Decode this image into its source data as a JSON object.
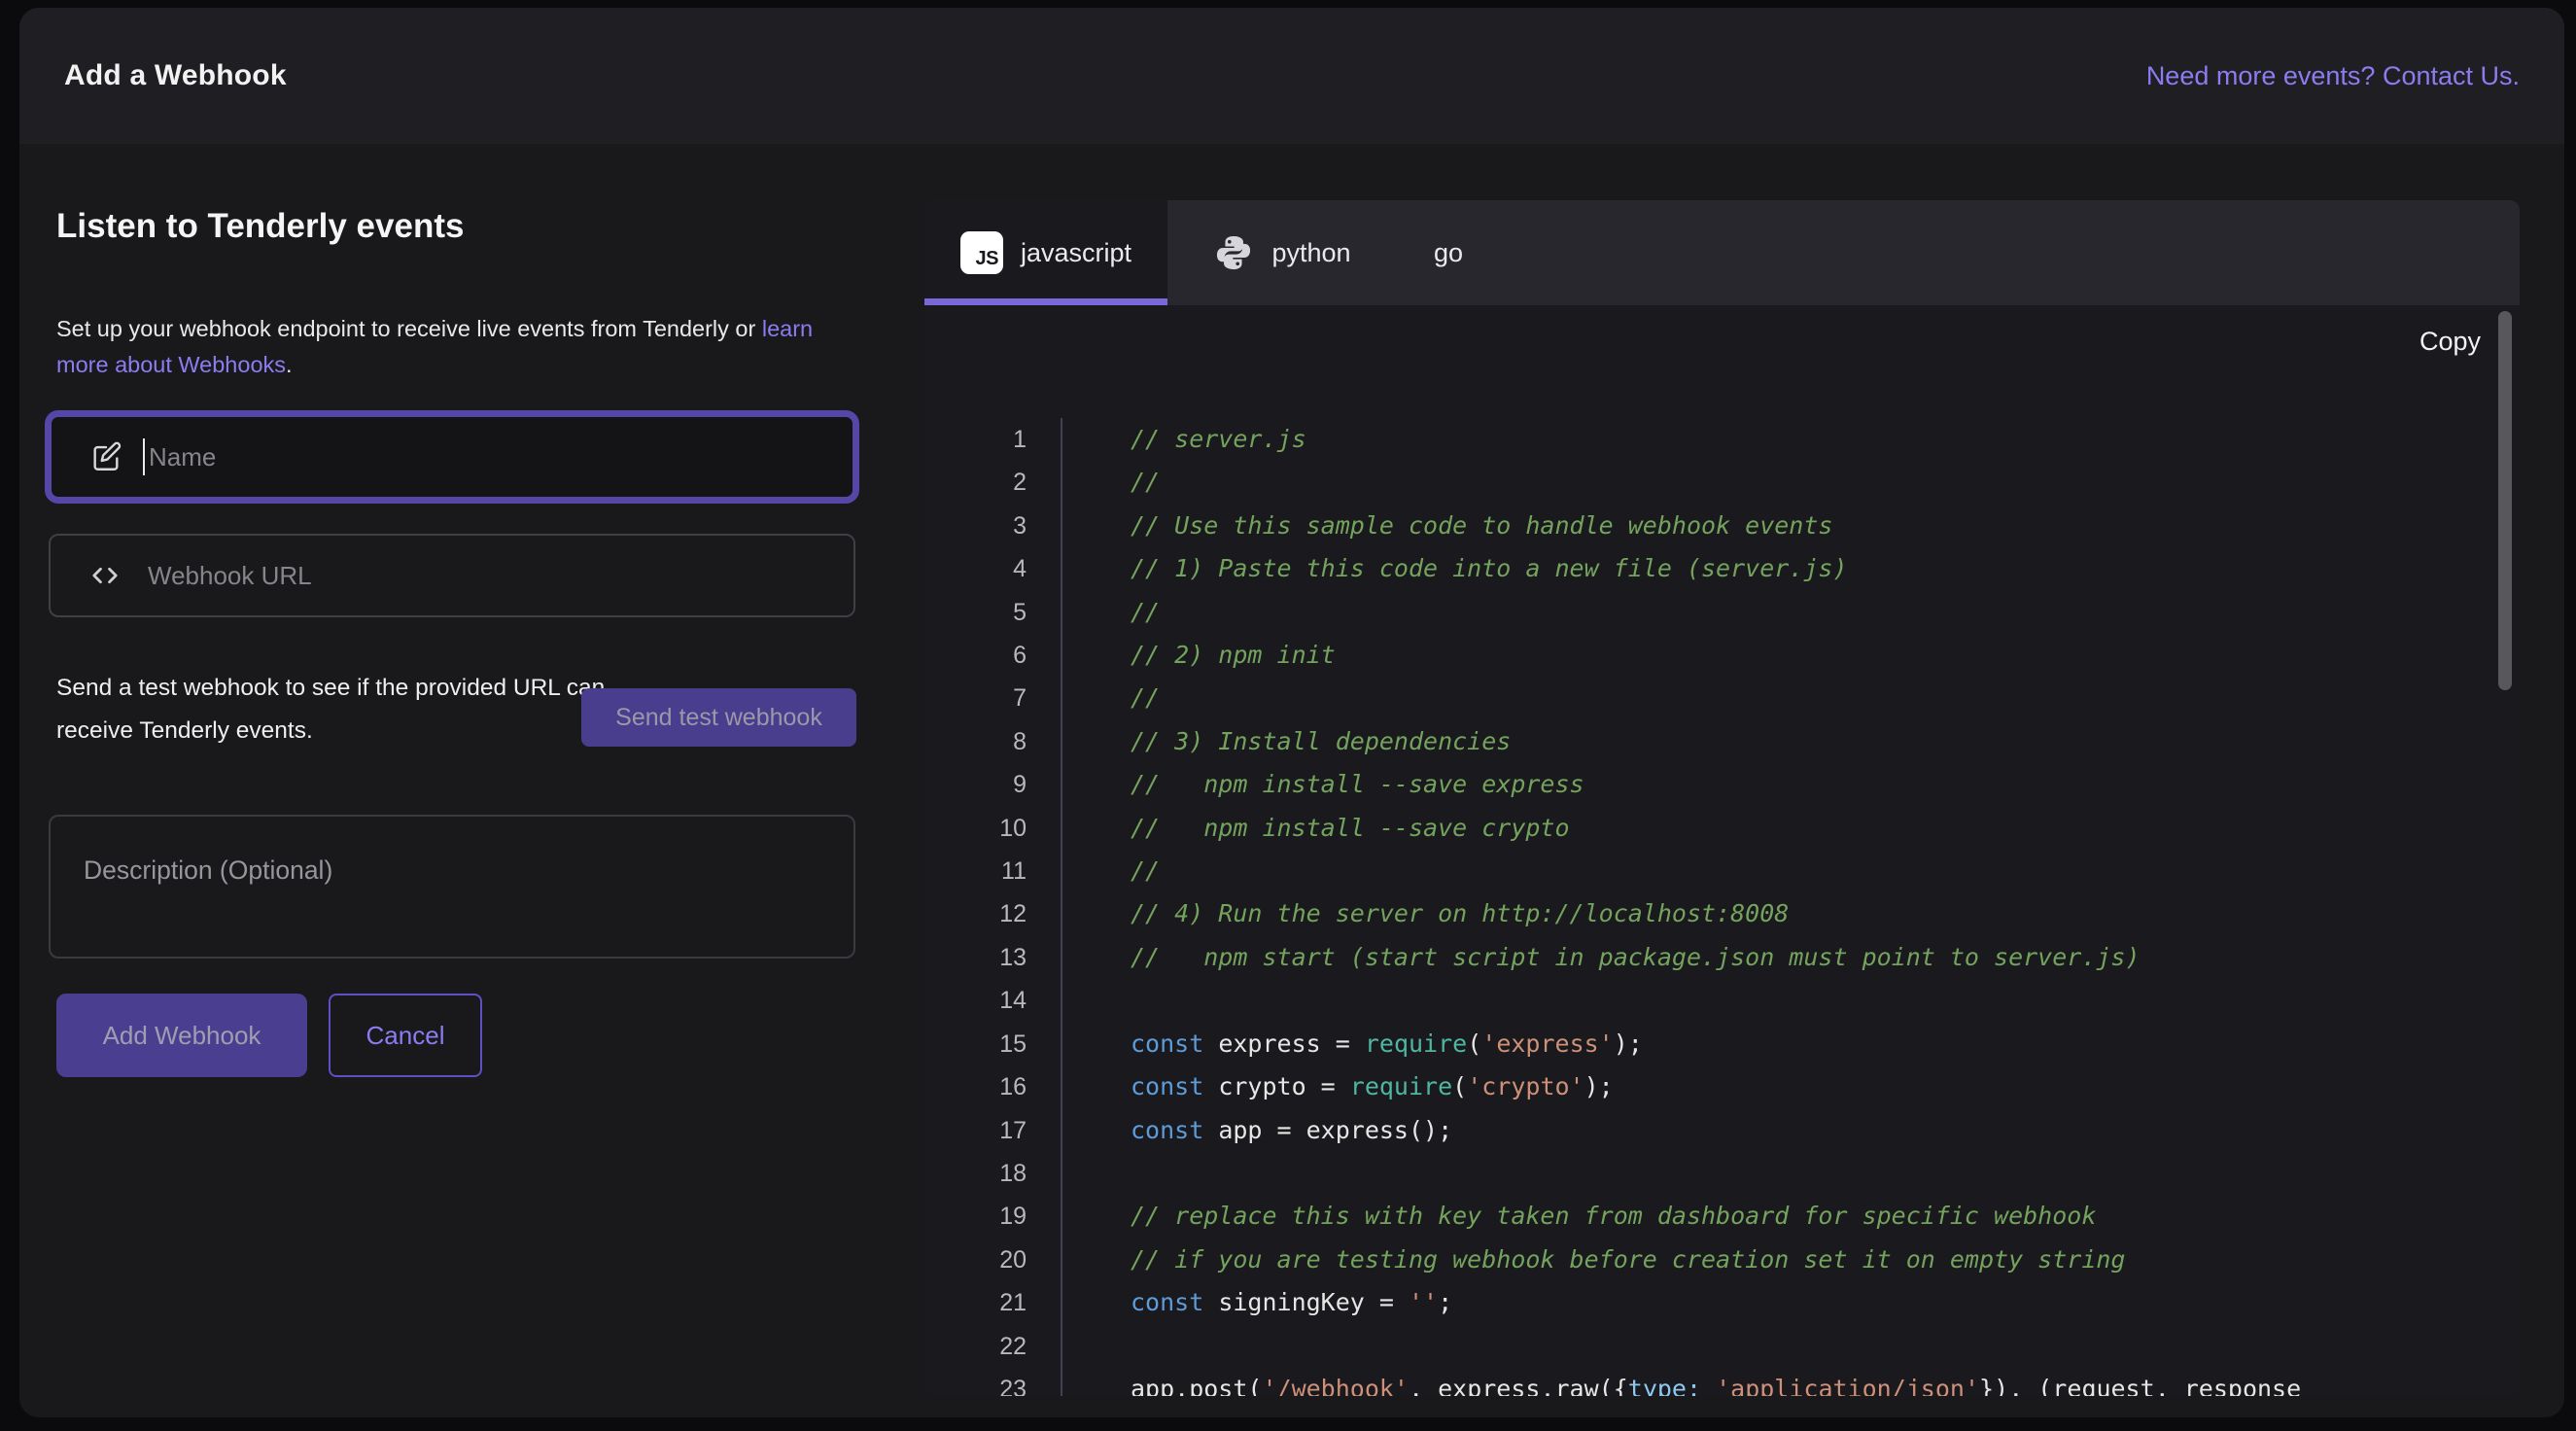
{
  "header": {
    "title": "Add a Webhook",
    "link": "Need more events? Contact Us."
  },
  "form": {
    "heading": "Listen to Tenderly events",
    "description_before": "Set up your webhook endpoint to receive live events from Tenderly or ",
    "description_link": "learn more about Webhooks",
    "description_after": ".",
    "name_placeholder": "Name",
    "url_placeholder": "Webhook URL",
    "test_text": "Send a test webhook to see if the provided URL can receive Tenderly events.",
    "test_button_label": "Send test webhook",
    "description_placeholder": "Description (Optional)",
    "submit_label": "Add Webhook",
    "cancel_label": "Cancel"
  },
  "code_panel": {
    "tabs": [
      {
        "label": "javascript",
        "icon": "js-icon",
        "icon_text": "JS",
        "active": true
      },
      {
        "label": "python",
        "icon": "python-icon",
        "active": false
      },
      {
        "label": "go",
        "icon": "",
        "active": false
      }
    ],
    "copy_label": "Copy",
    "lines": [
      [
        [
          "cm",
          "// server.js"
        ]
      ],
      [
        [
          "cm",
          "//"
        ]
      ],
      [
        [
          "cm",
          "// Use this sample code to handle webhook events"
        ]
      ],
      [
        [
          "cm",
          "// 1) Paste this code into a new file (server.js)"
        ]
      ],
      [
        [
          "cm",
          "//"
        ]
      ],
      [
        [
          "cm",
          "// 2) npm init"
        ]
      ],
      [
        [
          "cm",
          "//"
        ]
      ],
      [
        [
          "cm",
          "// 3) Install dependencies"
        ]
      ],
      [
        [
          "cm",
          "//   npm install --save express"
        ]
      ],
      [
        [
          "cm",
          "//   npm install --save crypto"
        ]
      ],
      [
        [
          "cm",
          "//"
        ]
      ],
      [
        [
          "cm",
          "// 4) Run the server on http://localhost:8008"
        ]
      ],
      [
        [
          "cm",
          "//   npm start (start script in package.json must point to server.js)"
        ]
      ],
      [],
      [
        [
          "kw",
          "const"
        ],
        [
          "pl",
          " express = "
        ],
        [
          "fn",
          "require"
        ],
        [
          "pl",
          "("
        ],
        [
          "str",
          "'express'"
        ],
        [
          "pl",
          ");"
        ]
      ],
      [
        [
          "kw",
          "const"
        ],
        [
          "pl",
          " crypto = "
        ],
        [
          "fn",
          "require"
        ],
        [
          "pl",
          "("
        ],
        [
          "str",
          "'crypto'"
        ],
        [
          "pl",
          ");"
        ]
      ],
      [
        [
          "kw",
          "const"
        ],
        [
          "pl",
          " app = express();"
        ]
      ],
      [],
      [
        [
          "cm",
          "// replace this with key taken from dashboard for specific webhook"
        ]
      ],
      [
        [
          "cm",
          "// if you are testing webhook before creation set it on empty string"
        ]
      ],
      [
        [
          "kw",
          "const"
        ],
        [
          "pl",
          " signingKey = "
        ],
        [
          "str",
          "''"
        ],
        [
          "pl",
          ";"
        ]
      ],
      [],
      [
        [
          "pl",
          "app.post("
        ],
        [
          "str",
          "'/webhook'"
        ],
        [
          "pl",
          ", express.raw({"
        ],
        [
          "ty",
          "type:"
        ],
        [
          "pl",
          " "
        ],
        [
          "str",
          "'application/json'"
        ],
        [
          "pl",
          "}), (request, response"
        ]
      ]
    ]
  },
  "colors": {
    "accent_purple": "#8b7cf0",
    "focus_border": "#5447a8",
    "button_purple": "#4a3e90",
    "tab_underline": "#7a68d8",
    "comment_green": "#73a35d",
    "keyword_blue": "#5d9cd8",
    "function_teal": "#4fb6a2",
    "string_salmon": "#cd9078"
  }
}
